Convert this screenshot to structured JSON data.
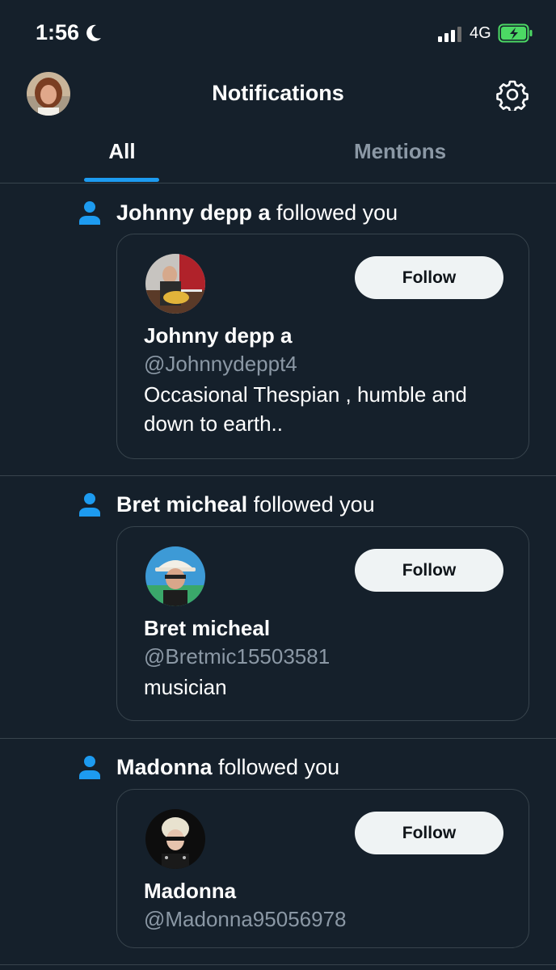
{
  "status_bar": {
    "time": "1:56",
    "network": "4G",
    "icons": [
      "moon-icon",
      "signal-icon",
      "battery-charging-icon"
    ]
  },
  "header": {
    "title": "Notifications",
    "icons": [
      "avatar",
      "gear-icon"
    ]
  },
  "tabs": [
    {
      "label": "All",
      "active": true
    },
    {
      "label": "Mentions",
      "active": false
    }
  ],
  "colors": {
    "background": "#15202b",
    "accent": "#1d9bf0",
    "muted": "#8b98a5",
    "divider": "#38444d",
    "button_bg": "#eff3f4"
  },
  "notifications": [
    {
      "actor": "Johnny depp a",
      "action": "followed you",
      "card": {
        "name": "Johnny depp a",
        "handle": "@Johnnydeppt4",
        "bio": "Occasional Thespian , humble and down to earth..",
        "button": "Follow"
      }
    },
    {
      "actor": "Bret micheal",
      "action": "followed you",
      "card": {
        "name": "Bret micheal",
        "handle": "@Bretmic15503581",
        "bio": "musician",
        "button": "Follow"
      }
    },
    {
      "actor": "Madonna",
      "action": "followed you",
      "card": {
        "name": "Madonna",
        "handle": "@Madonna95056978",
        "bio": "",
        "button": "Follow"
      }
    }
  ]
}
